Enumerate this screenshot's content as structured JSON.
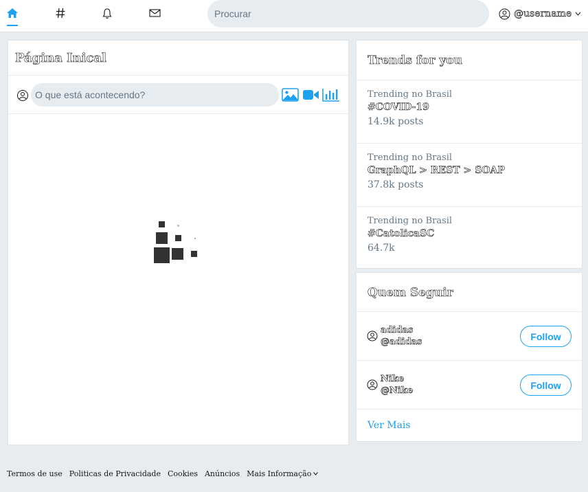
{
  "nav": {
    "icons": [
      "home-icon",
      "hashtag-icon",
      "bell-icon",
      "mail-icon"
    ],
    "active": "home-icon",
    "search_placeholder": "Procurar",
    "username": "@username"
  },
  "main": {
    "title": "Página Inical",
    "compose_placeholder": "O que está acontecendo?",
    "compose_tools": [
      "image-icon",
      "video-icon",
      "poll-icon"
    ]
  },
  "trends": {
    "title": "Trends for you",
    "items": [
      {
        "context": "Trending no Brasil",
        "name": "#COVID-19",
        "count": "14.9k posts"
      },
      {
        "context": "Trending no Brasil",
        "name": "GraphQL > REST > SOAP",
        "count": "37.8k posts"
      },
      {
        "context": "Trending no Brasil",
        "name": "#CatolicaSC",
        "count": "64.7k"
      }
    ]
  },
  "who_to_follow": {
    "title": "Quem Seguir",
    "users": [
      {
        "name": "adidas",
        "handle": "@adidas",
        "button": "Follow"
      },
      {
        "name": "Nike",
        "handle": "@Nike",
        "button": "Follow"
      }
    ],
    "see_more": "Ver Mais"
  },
  "footer": {
    "links": [
      "Termos de use",
      "Politicas de Privacidade",
      "Cookies",
      "Anúncios"
    ],
    "more": "Mais Informação"
  },
  "colors": {
    "accent": "#1da1f2",
    "background": "#e6ecf0",
    "text": "#14171a",
    "muted": "#657786"
  }
}
